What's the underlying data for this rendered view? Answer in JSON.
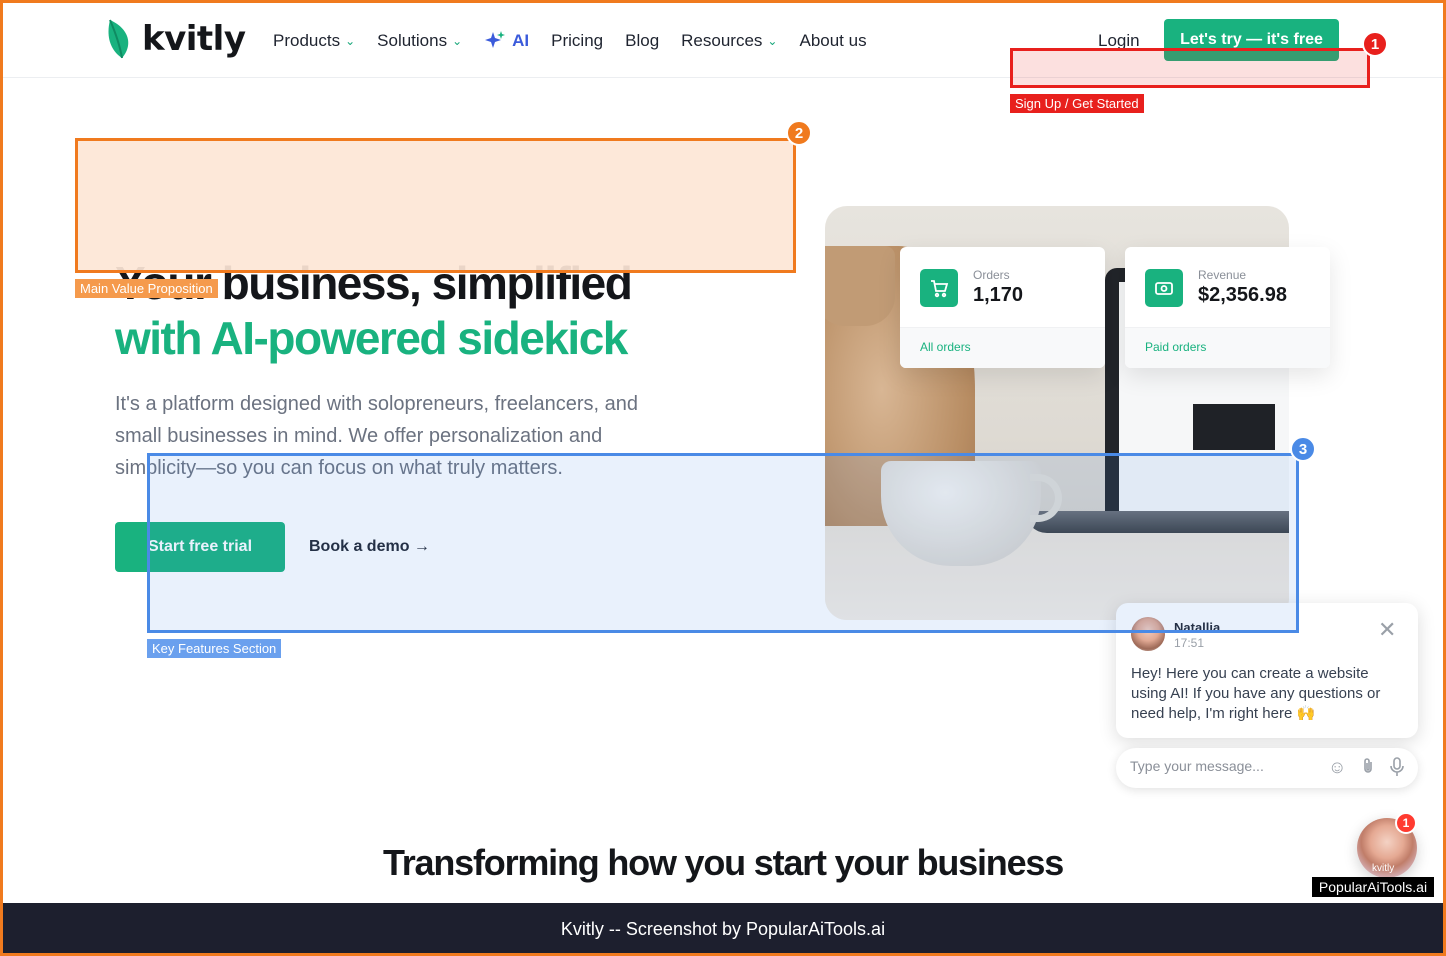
{
  "nav": {
    "logo_text": "kvitly",
    "items": [
      {
        "label": "Products",
        "dropdown": true
      },
      {
        "label": "Solutions",
        "dropdown": true
      },
      {
        "label": "AI",
        "dropdown": false
      },
      {
        "label": "Pricing",
        "dropdown": false
      },
      {
        "label": "Blog",
        "dropdown": false
      },
      {
        "label": "Resources",
        "dropdown": true
      },
      {
        "label": "About us",
        "dropdown": false
      }
    ],
    "login": "Login",
    "cta": "Let's try — it's free"
  },
  "hero": {
    "title_line1": "Your business, simplified",
    "title_line2": "with AI-powered sidekick",
    "lead": "It's a platform designed with solopreneurs, freelancers, and small businesses in mind. We offer personalization and simplicity—so you can focus on what truly matters.",
    "primary_button": "Start free trial",
    "secondary_button": "Book a demo →"
  },
  "stats": {
    "orders": {
      "label": "Orders",
      "value": "1,170",
      "link": "All orders",
      "icon": "cart-icon"
    },
    "revenue": {
      "label": "Revenue",
      "value": "$2,356.98",
      "link": "Paid orders",
      "icon": "cash-icon"
    }
  },
  "annotations": [
    {
      "number": "1",
      "label": "Sign Up / Get Started",
      "color": "#e8201d"
    },
    {
      "number": "2",
      "label": "Main Value Proposition",
      "color": "#f07a1e"
    },
    {
      "number": "3",
      "label": "Key Features Section",
      "color": "#4a8ae6"
    }
  ],
  "chat": {
    "agent_name": "Natallia",
    "time": "17:51",
    "message": "Hey! Here you can create a website using AI! If you have any questions or need help, I'm right here 🙌",
    "input_placeholder": "Type your message...",
    "badge_count": "1",
    "bubble_caption": "kvitly"
  },
  "section": {
    "title": "Transforming how you start your business"
  },
  "watermark": "PopularAiTools.ai",
  "footer": "Kvitly -- Screenshot by PopularAiTools.ai",
  "colors": {
    "brand_green": "#19b27f",
    "ai_blue": "#3b5bdb",
    "frame_orange": "#f07a1e",
    "footer_bg": "#1d1f2e"
  }
}
